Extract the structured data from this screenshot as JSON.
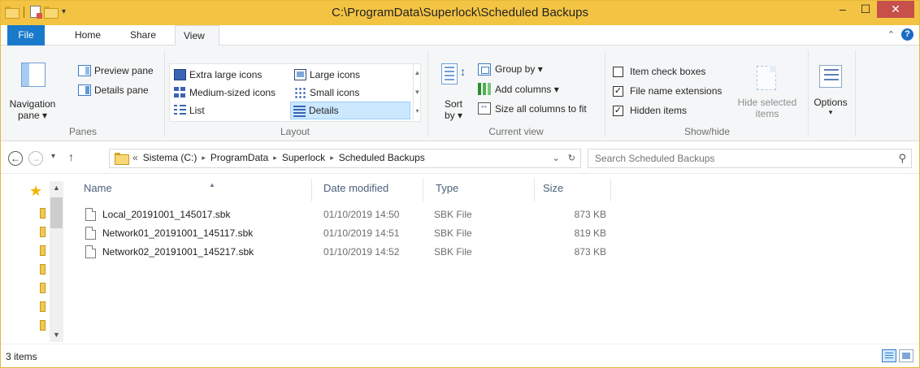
{
  "window": {
    "title": "C:\\ProgramData\\Superlock\\Scheduled Backups",
    "minimize_glyph": "‒",
    "maximize_glyph": "☐",
    "close_glyph": "✕",
    "accent_color": "#f3c443"
  },
  "ribbon_tabs": {
    "file": "File",
    "home": "Home",
    "share": "Share",
    "view": "View",
    "collapse_glyph": "⌃",
    "help_glyph": "?"
  },
  "ribbon": {
    "panes": {
      "navigation_pane": "Navigation",
      "navigation_pane_line2": "pane ▾",
      "preview_pane": "Preview pane",
      "details_pane": "Details pane",
      "label": "Panes"
    },
    "layout": {
      "items": [
        {
          "label": "Extra large icons",
          "icon": "extra-large-icons-icon"
        },
        {
          "label": "Large icons",
          "icon": "large-icons-icon"
        },
        {
          "label": "Medium-sized icons",
          "icon": "medium-icons-icon"
        },
        {
          "label": "Small icons",
          "icon": "small-icons-icon"
        },
        {
          "label": "List",
          "icon": "list-icon"
        },
        {
          "label": "Details",
          "icon": "details-icon",
          "selected": true
        }
      ],
      "label": "Layout"
    },
    "current_view": {
      "sort_by": "Sort",
      "sort_by_line2": "by ▾",
      "group_by": "Group by ▾",
      "add_columns": "Add columns ▾",
      "size_all_columns": "Size all columns to fit",
      "label": "Current view"
    },
    "show_hide": {
      "item_check_boxes": "Item check boxes",
      "item_check_boxes_checked": false,
      "file_name_extensions": "File name extensions",
      "file_name_extensions_checked": true,
      "hidden_items": "Hidden items",
      "hidden_items_checked": true,
      "hide_selected": "Hide selected",
      "hide_selected_line2": "items",
      "label": "Show/hide"
    },
    "options": {
      "label": "Options",
      "dropdown_glyph": "▾"
    }
  },
  "address_bar": {
    "back_glyph": "←",
    "forward_glyph": "→",
    "recent_glyph": "▾",
    "up_glyph": "↑",
    "overflow": "«",
    "crumbs": [
      "Sistema (C:)",
      "ProgramData",
      "Superlock",
      "Scheduled Backups"
    ],
    "crumb_separator": "▸",
    "dropdown_glyph": "⌄",
    "refresh_glyph": "↻"
  },
  "search": {
    "placeholder": "Search Scheduled Backups",
    "icon_glyph": "⚲"
  },
  "file_list": {
    "columns": [
      "Name",
      "Date modified",
      "Type",
      "Size"
    ],
    "rows": [
      {
        "name": "Local_20191001_145017.sbk",
        "date": "01/10/2019 14:50",
        "type": "SBK File",
        "size": "873 KB"
      },
      {
        "name": "Network01_20191001_145117.sbk",
        "date": "01/10/2019 14:51",
        "type": "SBK File",
        "size": "819 KB"
      },
      {
        "name": "Network02_20191001_145217.sbk",
        "date": "01/10/2019 14:52",
        "type": "SBK File",
        "size": "873 KB"
      }
    ]
  },
  "nav_pane": {
    "star_glyph": "★",
    "scroll_up_glyph": "▲",
    "scroll_down_glyph": "▼"
  },
  "status_bar": {
    "item_count": "3 items"
  }
}
